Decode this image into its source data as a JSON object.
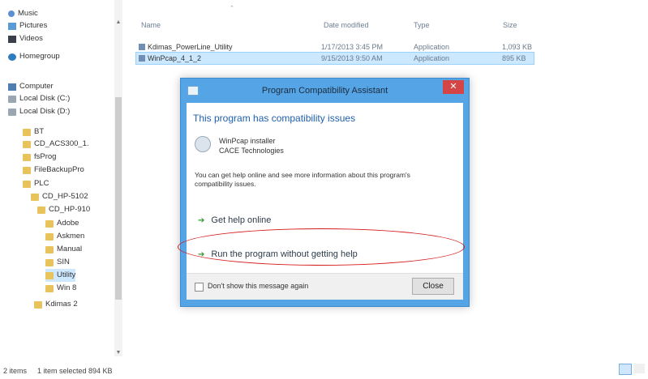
{
  "nav": {
    "items": [
      {
        "label": "Music",
        "icon": "music-icon"
      },
      {
        "label": "Pictures",
        "icon": "pictures-icon"
      },
      {
        "label": "Videos",
        "icon": "videos-icon"
      },
      {
        "label": "Homegroup",
        "icon": "homegroup-icon"
      },
      {
        "label": "Computer",
        "icon": "computer-icon"
      },
      {
        "label": "Local Disk (C:)",
        "icon": "disk-icon"
      },
      {
        "label": "Local Disk (D:)",
        "icon": "disk-icon"
      },
      {
        "label": "BT",
        "icon": "folder-icon"
      },
      {
        "label": "CD_ACS300_1.",
        "icon": "folder-icon"
      },
      {
        "label": "fsProg",
        "icon": "folder-icon"
      },
      {
        "label": "FileBackupPro",
        "icon": "folder-icon"
      },
      {
        "label": "PLC",
        "icon": "folder-icon"
      },
      {
        "label": "CD_HP-5102",
        "icon": "folder-icon"
      },
      {
        "label": "CD_HP-910",
        "icon": "folder-icon"
      },
      {
        "label": "Adobe",
        "icon": "folder-icon"
      },
      {
        "label": "Askmen",
        "icon": "folder-icon"
      },
      {
        "label": "Manual",
        "icon": "folder-icon"
      },
      {
        "label": "SIN",
        "icon": "folder-icon"
      },
      {
        "label": "Utility",
        "icon": "folder-icon"
      },
      {
        "label": "Win 8",
        "icon": "folder-icon"
      },
      {
        "label": "Kdimas 2",
        "icon": "folder-icon"
      }
    ]
  },
  "columns": {
    "name": "Name",
    "date": "Date modified",
    "type": "Type",
    "size": "Size"
  },
  "files": [
    {
      "name": "Kdimas_PowerLine_Utility",
      "date": "1/17/2013 3:45 PM",
      "type": "Application",
      "size": "1,093 KB"
    },
    {
      "name": "WinPcap_4_1_2",
      "date": "9/15/2013 9:50 AM",
      "type": "Application",
      "size": "895 KB"
    }
  ],
  "status": {
    "items": "2 items",
    "selected": "1 item selected  894 KB"
  },
  "dialog": {
    "title": "Program Compatibility Assistant",
    "close_glyph": "✕",
    "heading": "This program has compatibility issues",
    "program_name": "WinPcap installer",
    "publisher": "CACE Technologies",
    "info": "You can get help online and see more information about this program's compatibility issues.",
    "option_help": "Get help online",
    "option_run": "Run the program without getting help",
    "checkbox_label": "Don't show this message again",
    "close_button": "Close",
    "arrow_glyph": "➔"
  },
  "colors": {
    "dialog_frame": "#55a4e6",
    "heading": "#1f5fad",
    "highlight": "#d51a1a",
    "option_arrow": "#2f9b2f"
  }
}
